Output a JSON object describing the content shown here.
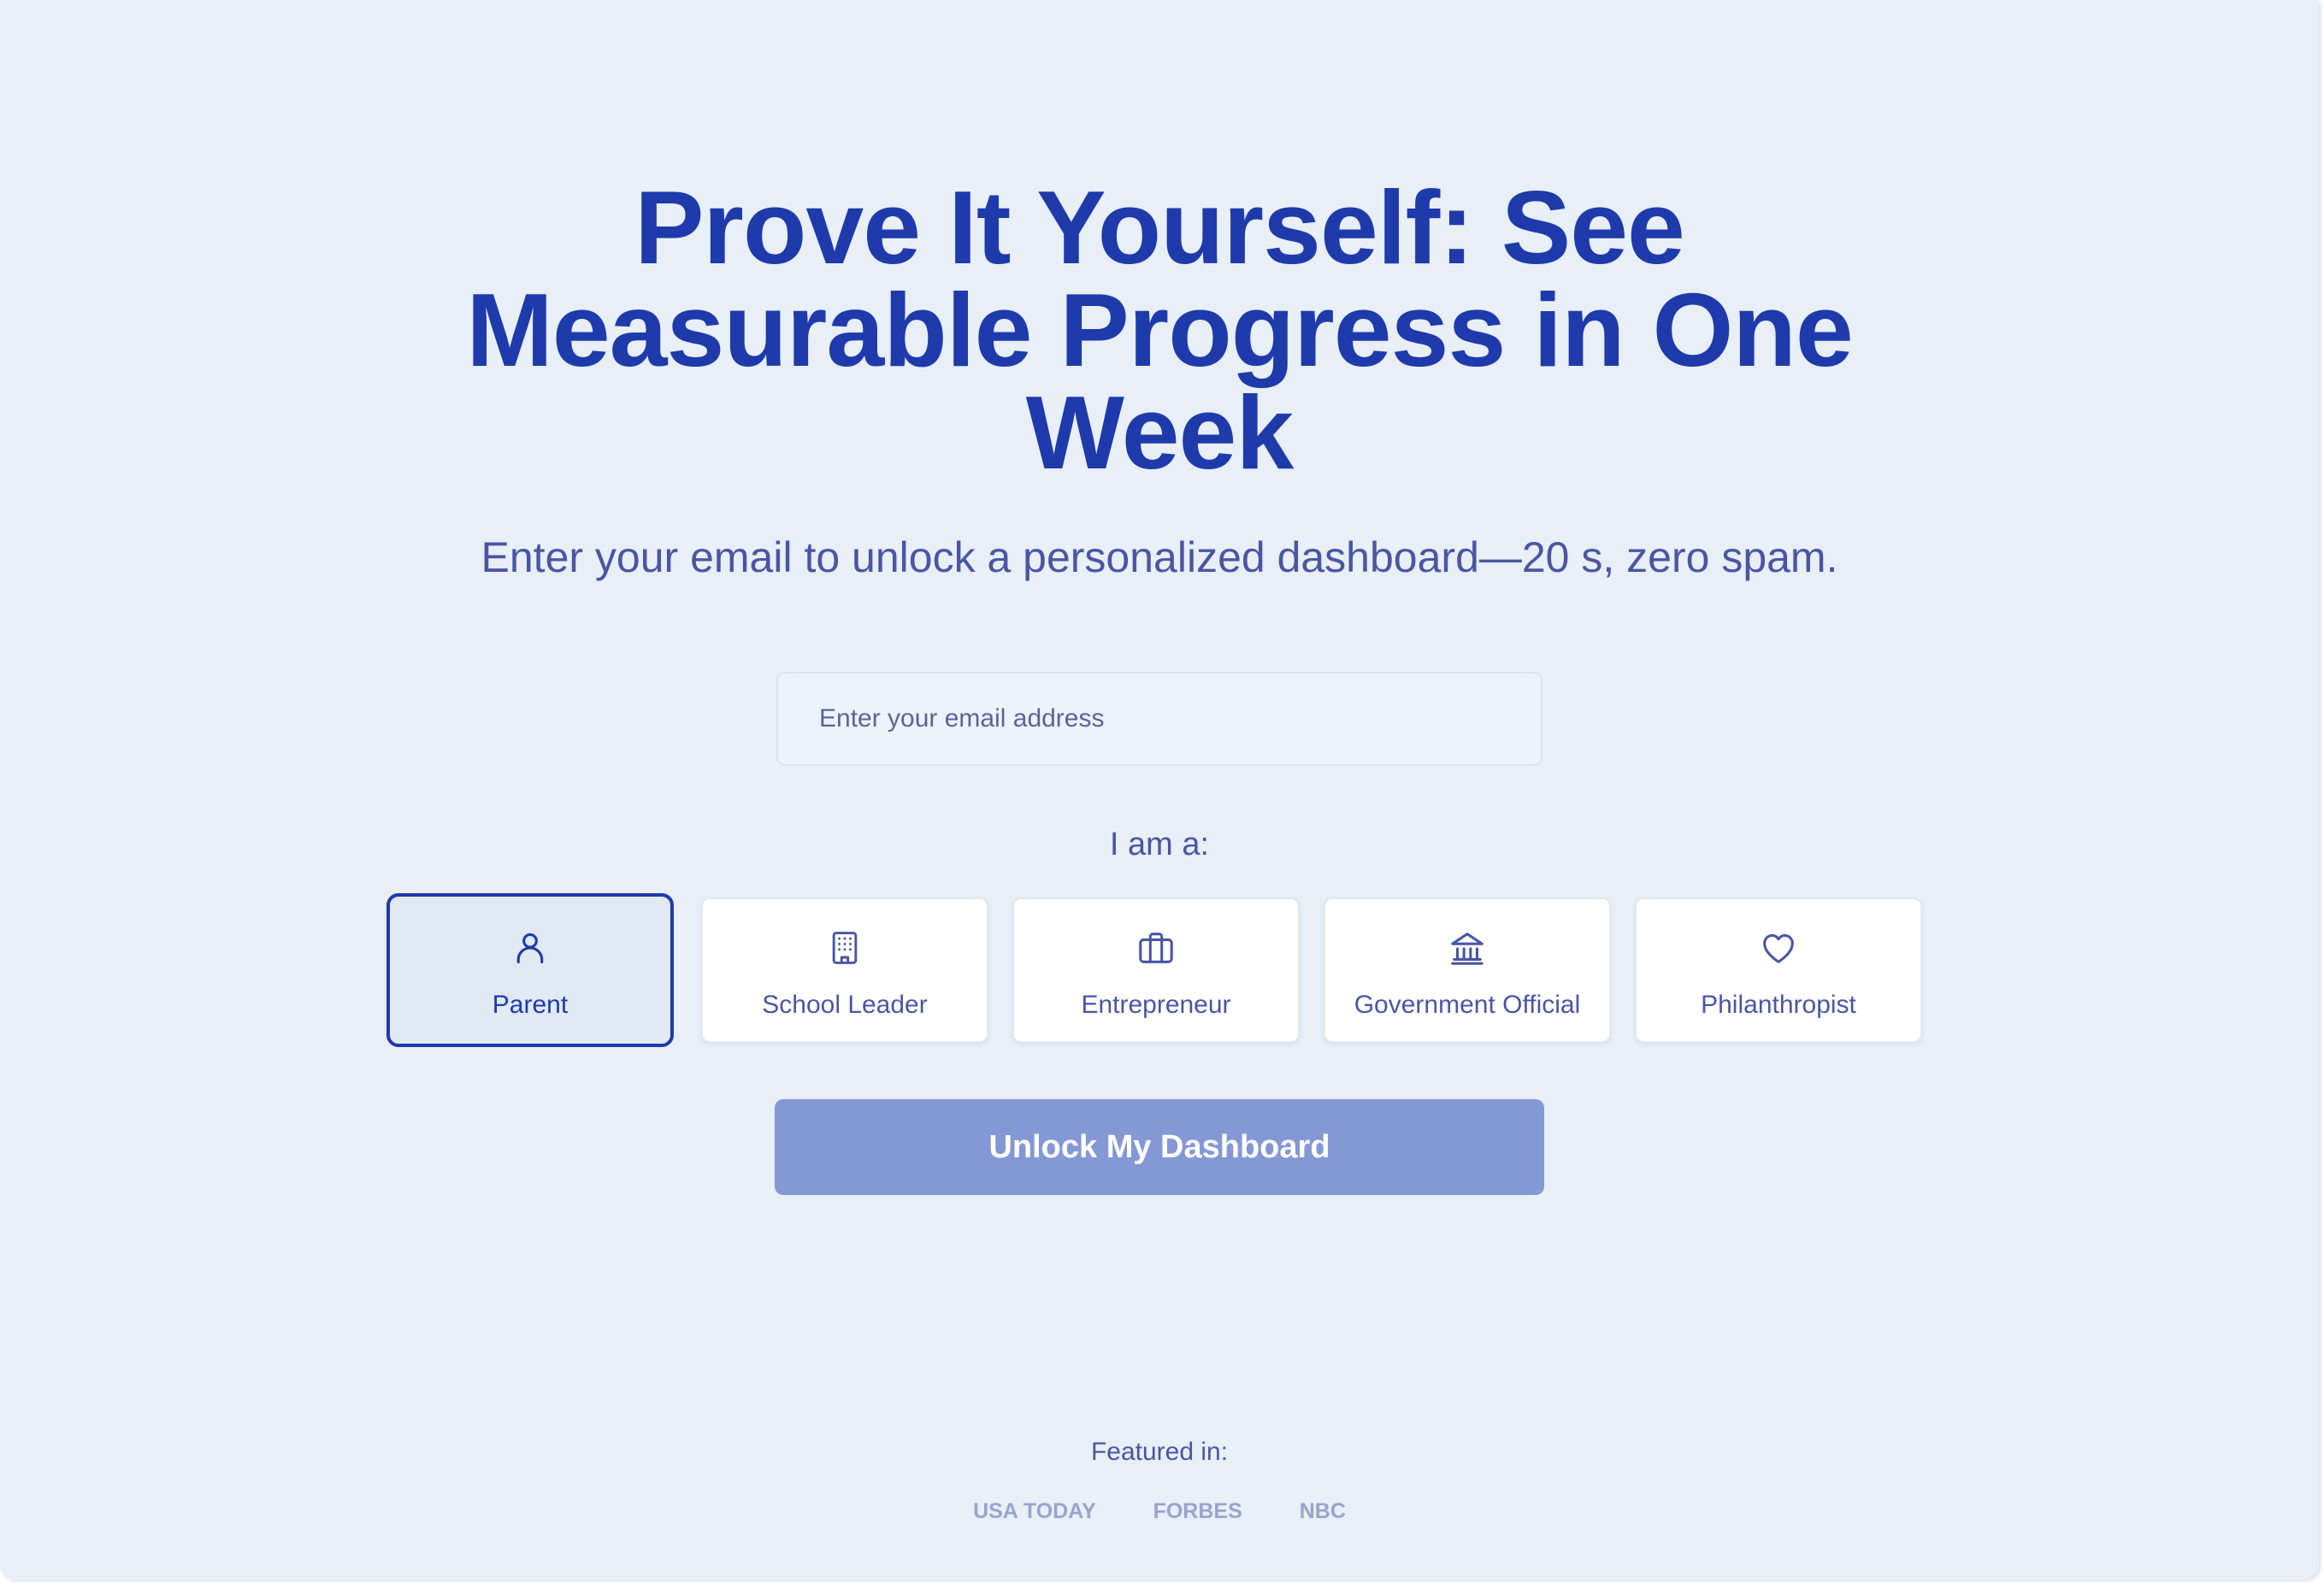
{
  "headline": {
    "line1": "Prove It Yourself: See",
    "line2": "Measurable Progress in One",
    "line3": "Week"
  },
  "subheadline": "Enter your email to unlock a personalized dashboard—20 s, zero spam.",
  "email_field": {
    "value": "",
    "placeholder": "Enter your email address"
  },
  "role_prompt": "I am a:",
  "roles": [
    {
      "label": "Parent",
      "icon": "user-icon",
      "selected": true
    },
    {
      "label": "School Leader",
      "icon": "building-icon",
      "selected": false
    },
    {
      "label": "Entrepreneur",
      "icon": "briefcase-icon",
      "selected": false
    },
    {
      "label": "Government Official",
      "icon": "landmark-icon",
      "selected": false
    },
    {
      "label": "Philanthropist",
      "icon": "heart-icon",
      "selected": false
    }
  ],
  "cta_label": "Unlock My Dashboard",
  "featured": {
    "label": "Featured in:",
    "outlets": [
      "USA TODAY",
      "FORBES",
      "NBC"
    ]
  },
  "colors": {
    "background": "#e8eff7",
    "primary": "#1e3aab",
    "text_muted": "#4a56a3",
    "button_disabled": "#8498d6",
    "press_logo": "#9aa3cc"
  }
}
